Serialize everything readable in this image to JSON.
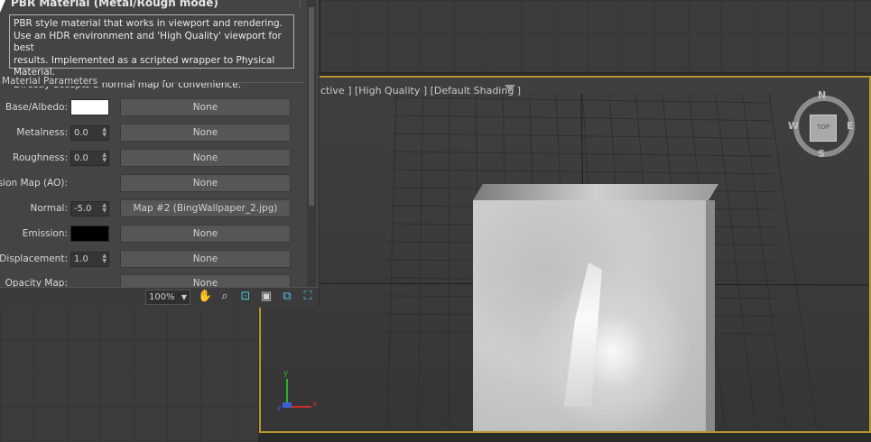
{
  "panel": {
    "title": "PBR Material (Metal/Rough mode)",
    "description": [
      "PBR style material that works in viewport and rendering.",
      "Use an HDR environment and 'High Quality' viewport for best",
      "results. Implemented as a scripted wrapper to Physical Material.",
      "Directly accepts a normal map for convenience."
    ],
    "group_label": "Material Parameters",
    "rows": [
      {
        "label": "Base/Albedo:",
        "kind": "color",
        "color": "#ffffff",
        "map": "None"
      },
      {
        "label": "Metalness:",
        "kind": "spinner",
        "value": "0.0",
        "map": "None"
      },
      {
        "label": "Roughness:",
        "kind": "spinner",
        "value": "0.0",
        "map": "None"
      },
      {
        "label": "Occlusion Map (AO):",
        "kind": "none",
        "map": "None"
      },
      {
        "label": "Normal:",
        "kind": "spinner",
        "value": "-5.0",
        "map": "Map #2 (BingWallpaper_2.jpg)"
      },
      {
        "label": "Emission:",
        "kind": "color",
        "color": "#000000",
        "map": "None"
      },
      {
        "label": "Displacement:",
        "kind": "spinner",
        "value": "1.0",
        "map": "None"
      },
      {
        "label": "Opacity Map:",
        "kind": "none",
        "map": "None"
      }
    ]
  },
  "toolbar": {
    "zoom": "100%",
    "icons": [
      "pan-hand-icon",
      "zoom-magnifier-icon",
      "zoom-extents-icon",
      "zoom-selected-icon",
      "maximize-viewport-icon",
      "pan-view-icon"
    ]
  },
  "viewport": {
    "label": "ctive ] [High Quality ] [Default Shading ]",
    "viewcube": {
      "top": "TOP",
      "n": "N",
      "s": "S",
      "e": "E",
      "w": "W"
    },
    "axes": {
      "x": "x",
      "y": "y",
      "z": "z"
    }
  },
  "colors": {
    "active_viewport_border": "#b8962e",
    "panel_bg": "#444444"
  }
}
